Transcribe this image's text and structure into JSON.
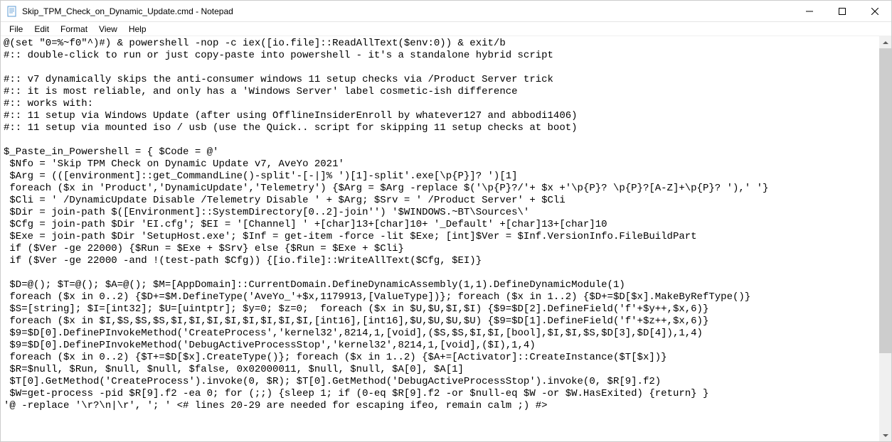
{
  "window": {
    "title": "Skip_TPM_Check_on_Dynamic_Update.cmd - Notepad"
  },
  "menu": {
    "file": "File",
    "edit": "Edit",
    "format": "Format",
    "view": "View",
    "help": "Help"
  },
  "content": "@(set \"0=%~f0\"^)#) & powershell -nop -c iex([io.file]::ReadAllText($env:0)) & exit/b\n#:: double-click to run or just copy-paste into powershell - it's a standalone hybrid script\n\n#:: v7 dynamically skips the anti-consumer windows 11 setup checks via /Product Server trick\n#:: it is most reliable, and only has a 'Windows Server' label cosmetic-ish difference\n#:: works with:\n#:: 11 setup via Windows Update (after using OfflineInsiderEnroll by whatever127 and abbodi1406)\n#:: 11 setup via mounted iso / usb (use the Quick.. script for skipping 11 setup checks at boot)\n\n$_Paste_in_Powershell = { $Code = @'\n $Nfo = 'Skip TPM Check on Dynamic Update v7, AveYo 2021'\n $Arg = (([environment]::get_CommandLine()-split'-[-|]% ')[1]-split'.exe[\\p{P}]? ')[1]\n foreach ($x in 'Product','DynamicUpdate','Telemetry') {$Arg = $Arg -replace $('\\p{P}?/'+ $x +'\\p{P}? \\p{P}?[A-Z]+\\p{P}? '),' '}\n $Cli = ' /DynamicUpdate Disable /Telemetry Disable ' + $Arg; $Srv = ' /Product Server' + $Cli\n $Dir = join-path $([Environment]::SystemDirectory[0..2]-join'') '$WINDOWS.~BT\\Sources\\'\n $Cfg = join-path $Dir 'EI.cfg'; $EI = '[Channel] ' +[char]13+[char]10+ '_Default' +[char]13+[char]10\n $Exe = join-path $Dir 'SetupHost.exe'; $Inf = get-item -force -lit $Exe; [int]$Ver = $Inf.VersionInfo.FileBuildPart\n if ($Ver -ge 22000) {$Run = $Exe + $Srv} else {$Run = $Exe + $Cli}\n if ($Ver -ge 22000 -and !(test-path $Cfg)) {[io.file]::WriteAllText($Cfg, $EI)}\n\n $D=@(); $T=@(); $A=@(); $M=[AppDomain]::CurrentDomain.DefineDynamicAssembly(1,1).DefineDynamicModule(1)\n foreach ($x in 0..2) {$D+=$M.DefineType('AveYo_'+$x,1179913,[ValueType])}; foreach ($x in 1..2) {$D+=$D[$x].MakeByRefType()}\n $S=[string]; $I=[int32]; $U=[uintptr]; $y=0; $z=0;  foreach ($x in $U,$U,$I,$I) {$9=$D[2].DefineField('f'+$y++,$x,6)}\n foreach ($x in $I,$S,$S,$S,$I,$I,$I,$I,$I,$I,$I,$I,[int16],[int16],$U,$U,$U,$U) {$9=$D[1].DefineField('f'+$z++,$x,6)}\n $9=$D[0].DefinePInvokeMethod('CreateProcess','kernel32',8214,1,[void],($S,$S,$I,$I,[bool],$I,$I,$S,$D[3],$D[4]),1,4)\n $9=$D[0].DefinePInvokeMethod('DebugActiveProcessStop','kernel32',8214,1,[void],($I),1,4)\n foreach ($x in 0..2) {$T+=$D[$x].CreateType()}; foreach ($x in 1..2) {$A+=[Activator]::CreateInstance($T[$x])}\n $R=$null, $Run, $null, $null, $false, 0x02000011, $null, $null, $A[0], $A[1]\n $T[0].GetMethod('CreateProcess').invoke(0, $R); $T[0].GetMethod('DebugActiveProcessStop').invoke(0, $R[9].f2)\n $W=get-process -pid $R[9].f2 -ea 0; for (;;) {sleep 1; if (0-eq $R[9].f2 -or $null-eq $W -or $W.HasExited) {return} }\n'@ -replace '\\r?\\n|\\r', '; ' <# lines 20-29 are needed for escaping ifeo, remain calm ;) #>"
}
